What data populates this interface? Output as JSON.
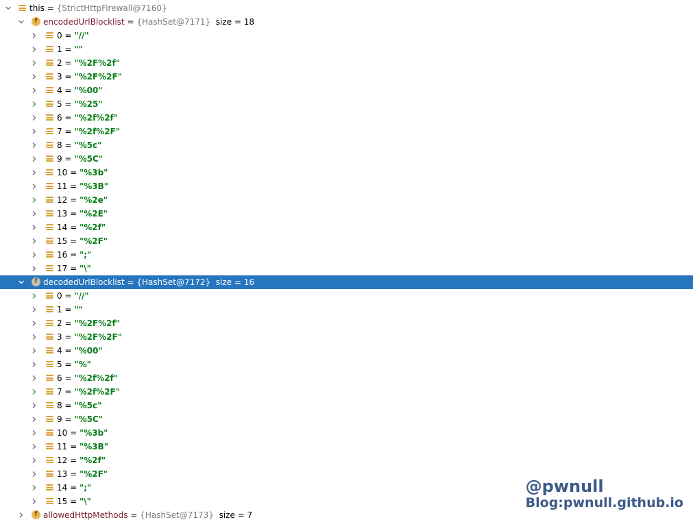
{
  "root": {
    "name": "this",
    "ref": "{StrictHttpFirewall@7160}"
  },
  "encoded": {
    "name": "encodedUrlBlocklist",
    "ref": "{HashSet@7171}",
    "size": "size = 18",
    "items": [
      {
        "index": "0",
        "value": "\"//\""
      },
      {
        "index": "1",
        "value": "\"\""
      },
      {
        "index": "2",
        "value": "\"%2F%2f\""
      },
      {
        "index": "3",
        "value": "\"%2F%2F\""
      },
      {
        "index": "4",
        "value": "\"%00\""
      },
      {
        "index": "5",
        "value": "\"%25\""
      },
      {
        "index": "6",
        "value": "\"%2f%2f\""
      },
      {
        "index": "7",
        "value": "\"%2f%2F\""
      },
      {
        "index": "8",
        "value": "\"%5c\""
      },
      {
        "index": "9",
        "value": "\"%5C\""
      },
      {
        "index": "10",
        "value": "\"%3b\""
      },
      {
        "index": "11",
        "value": "\"%3B\""
      },
      {
        "index": "12",
        "value": "\"%2e\""
      },
      {
        "index": "13",
        "value": "\"%2E\""
      },
      {
        "index": "14",
        "value": "\"%2f\""
      },
      {
        "index": "15",
        "value": "\"%2F\""
      },
      {
        "index": "16",
        "value": "\";\""
      },
      {
        "index": "17",
        "value": "\"\\\""
      }
    ]
  },
  "decoded": {
    "name": "decodedUrlBlocklist",
    "ref": "{HashSet@7172}",
    "size": "size = 16",
    "items": [
      {
        "index": "0",
        "value": "\"//\""
      },
      {
        "index": "1",
        "value": "\"\""
      },
      {
        "index": "2",
        "value": "\"%2F%2f\""
      },
      {
        "index": "3",
        "value": "\"%2F%2F\""
      },
      {
        "index": "4",
        "value": "\"%00\""
      },
      {
        "index": "5",
        "value": "\"%\""
      },
      {
        "index": "6",
        "value": "\"%2f%2f\""
      },
      {
        "index": "7",
        "value": "\"%2f%2F\""
      },
      {
        "index": "8",
        "value": "\"%5c\""
      },
      {
        "index": "9",
        "value": "\"%5C\""
      },
      {
        "index": "10",
        "value": "\"%3b\""
      },
      {
        "index": "11",
        "value": "\"%3B\""
      },
      {
        "index": "12",
        "value": "\"%2f\""
      },
      {
        "index": "13",
        "value": "\"%2F\""
      },
      {
        "index": "14",
        "value": "\";\""
      },
      {
        "index": "15",
        "value": "\"\\\""
      }
    ]
  },
  "truncated_next": {
    "name": "allowedHttpMethods",
    "ref": "{HashSet@7173}",
    "size": "size = 7"
  },
  "watermark": {
    "handle": "@pwnull",
    "blog": "Blog:pwnull.github.io"
  },
  "colors": {
    "selection": "#2675bf",
    "string_value": "#067d17",
    "field_name": "#7a1b2f",
    "ref": "#7b7b7b",
    "list_icon": "#d9a13a",
    "field_icon": "#e8b553"
  },
  "icons": {
    "expanded": "chevron-down-icon",
    "collapsed": "chevron-right-icon",
    "element": "list-icon",
    "field": "field-icon"
  }
}
